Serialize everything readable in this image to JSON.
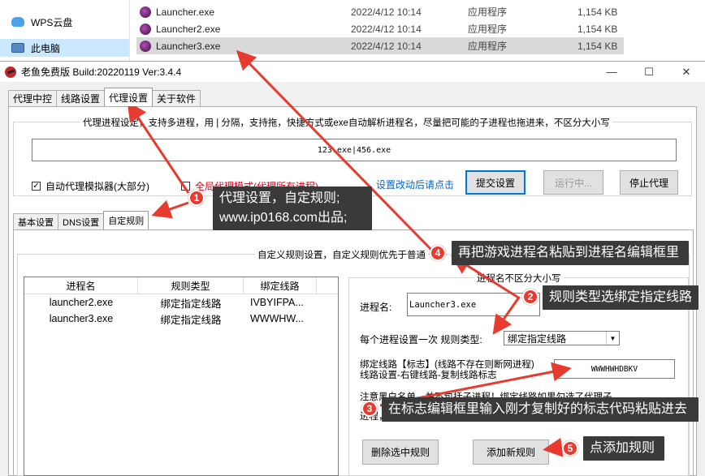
{
  "explorer": {
    "nav": [
      {
        "label": "WPS云盘",
        "icon": "cloud-icon"
      },
      {
        "label": "此电脑",
        "icon": "computer-icon"
      }
    ],
    "files": [
      {
        "name": "Launcher.exe",
        "date": "2022/4/12 10:14",
        "type": "应用程序",
        "size": "1,154 KB"
      },
      {
        "name": "Launcher2.exe",
        "date": "2022/4/12 10:14",
        "type": "应用程序",
        "size": "1,154 KB"
      },
      {
        "name": "Launcher3.exe",
        "date": "2022/4/12 10:14",
        "type": "应用程序",
        "size": "1,154 KB"
      }
    ]
  },
  "window": {
    "title": "老鱼免费版 Build:20220119 Ver:3.4.4",
    "controls": {
      "min": "—",
      "max": "☐",
      "close": "✕"
    }
  },
  "main_tabs": [
    "代理中控",
    "线路设置",
    "代理设置",
    "关于软件"
  ],
  "proxy": {
    "group_title": "代理进程设定，支持多进程，用 | 分隔，支持拖，快捷方式或exe自动解析进程名，尽量把可能的子进程也拖进来，不区分大小写",
    "process_value": "123.exe|456.exe",
    "auto_proxy_label": "自动代理模拟器(大部分)",
    "global_proxy_label": "全局代理模式(代理所有进程)",
    "hint_link": "设置改动后请点击",
    "submit_label": "提交设置",
    "running_label": "运行中...",
    "stop_label": "停止代理"
  },
  "sub_tabs": [
    "基本设置",
    "DNS设置",
    "自定规则"
  ],
  "rules": {
    "group_title": "自定义规则设置，自定义规则优先于普通",
    "columns": [
      "进程名",
      "规则类型",
      "绑定线路"
    ],
    "rows": [
      {
        "process": "launcher2.exe",
        "type": "绑定指定线路",
        "line": "IVBYIFPA..."
      },
      {
        "process": "launcher3.exe",
        "type": "绑定指定线路",
        "line": "WWWHW..."
      }
    ],
    "edit_title": "进程名不区分大小写",
    "process_label": "进程名:",
    "process_value": "Launcher3.exe",
    "rule_type_label": "每个进程设置一次 规则类型:",
    "rule_type_value": "绑定指定线路",
    "bind_label_1": "绑定线路【标志】(线路不存在则断网进程)",
    "bind_label_2": "线路设置-右键线路-复制线路标志",
    "bind_value": "WWWHWHDBKV",
    "note_1": "注意黑白名单，并不包括子进程！绑定线路如果勾选了代理子",
    "note_2": "进程，那子进程将绑定同一线路。",
    "delete_label": "删除选中规则",
    "add_label": "添加新规则"
  },
  "annotations": [
    {
      "num": "1",
      "text_1": "代理设置，自定规则;",
      "text_2": "www.ip0168.com出品;"
    },
    {
      "num": "2",
      "text_1": "规则类型选绑定指定线路"
    },
    {
      "num": "3",
      "text_1": "在标志编辑框里输入刚才复制好的标志代码粘贴进去"
    },
    {
      "num": "4",
      "text_1": "再把游戏进程名粘贴到进程名编辑框里"
    },
    {
      "num": "5",
      "text_1": "点添加规则"
    }
  ],
  "colors": {
    "accent": "#e63b2e",
    "callout_bg": "#3a3a3a",
    "link": "#0066cc",
    "focus": "#0078d7"
  }
}
